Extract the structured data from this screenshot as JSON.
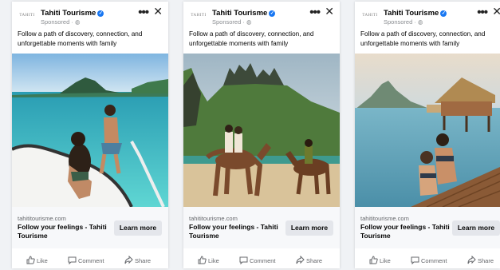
{
  "ads": [
    {
      "advertiser": "Tahiti Tourisme",
      "logo_text": "TAHITI",
      "sponsored": "Sponsored · ",
      "caption": "Follow a path of discovery, connection, and unforgettable moments with family",
      "domain": "tahititourisme.com",
      "headline": "Follow your feelings - Tahiti Tourisme",
      "cta": "Learn more",
      "actions": {
        "like": "Like",
        "comment": "Comment",
        "share": "Share"
      }
    },
    {
      "advertiser": "Tahiti Tourisme",
      "logo_text": "TAHITI",
      "sponsored": "Sponsored · ",
      "caption": "Follow a path of discovery, connection, and unforgettable moments with family",
      "domain": "tahititourisme.com",
      "headline": "Follow your feelings - Tahiti Tourisme",
      "cta": "Learn more",
      "actions": {
        "like": "Like",
        "comment": "Comment",
        "share": "Share"
      }
    },
    {
      "advertiser": "Tahiti Tourisme",
      "logo_text": "TAHITI",
      "sponsored": "Sponsored · ",
      "caption": "Follow a path of discovery, connection, and unforgettable moments with family",
      "domain": "tahititourisme.com",
      "headline": "Follow your feelings - Tahiti Tourisme",
      "cta": "Learn more",
      "actions": {
        "like": "Like",
        "comment": "Comment",
        "share": "Share"
      }
    }
  ],
  "icons": {
    "verified": "verified-badge-icon",
    "globe": "globe-icon",
    "more": "more-options-icon",
    "close": "close-icon",
    "like": "thumbs-up-icon",
    "comment": "comment-bubble-icon",
    "share": "share-arrow-icon"
  },
  "colors": {
    "verified": "#1877f2",
    "text": "#050505",
    "muted": "#65676b",
    "button": "#e4e6eb"
  }
}
